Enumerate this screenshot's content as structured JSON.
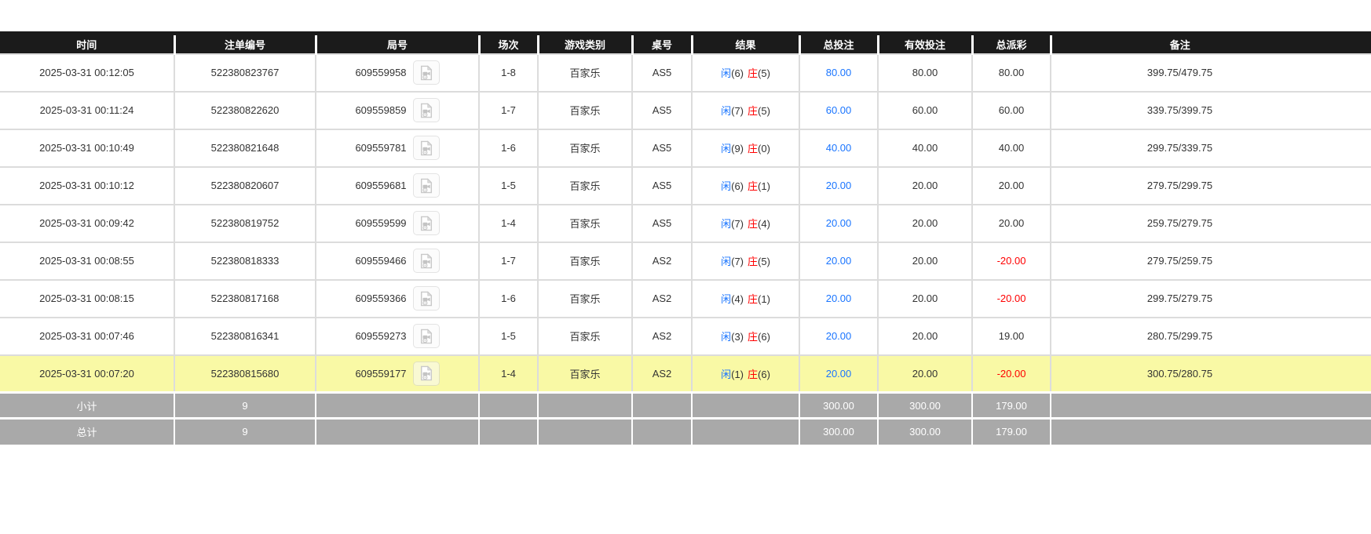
{
  "colors": {
    "header_bg": "#1b1b1b",
    "player_blue": "#1a75ff",
    "banker_red": "#ff0000",
    "bet_blue": "#1a75ff",
    "negative_red": "#ff0000",
    "highlight_yellow": "#f9f9a5",
    "footer_gray": "#a9a9a9"
  },
  "table": {
    "columns": [
      {
        "key": "time",
        "label": "时间"
      },
      {
        "key": "bet_id",
        "label": "注单编号"
      },
      {
        "key": "round",
        "label": "局号"
      },
      {
        "key": "session",
        "label": "场次"
      },
      {
        "key": "game_type",
        "label": "游戏类别"
      },
      {
        "key": "table_no",
        "label": "桌号"
      },
      {
        "key": "result",
        "label": "结果"
      },
      {
        "key": "total_bet",
        "label": "总投注"
      },
      {
        "key": "valid_bet",
        "label": "有效投注"
      },
      {
        "key": "total_payout",
        "label": "总派彩"
      },
      {
        "key": "remark",
        "label": "备注"
      }
    ],
    "rows": [
      {
        "time": "2025-03-31 00:12:05",
        "bet_id": "522380823767",
        "round": "609559958",
        "session": "1-8",
        "game_type": "百家乐",
        "table_no": "AS5",
        "result_player": "闲",
        "result_player_score": "(6)",
        "result_banker": "庄",
        "result_banker_score": "(5)",
        "total_bet": "80.00",
        "valid_bet": "80.00",
        "total_payout": "80.00",
        "remark": "399.75/479.75",
        "highlighted": false
      },
      {
        "time": "2025-03-31 00:11:24",
        "bet_id": "522380822620",
        "round": "609559859",
        "session": "1-7",
        "game_type": "百家乐",
        "table_no": "AS5",
        "result_player": "闲",
        "result_player_score": "(7)",
        "result_banker": "庄",
        "result_banker_score": "(5)",
        "total_bet": "60.00",
        "valid_bet": "60.00",
        "total_payout": "60.00",
        "remark": "339.75/399.75",
        "highlighted": false
      },
      {
        "time": "2025-03-31 00:10:49",
        "bet_id": "522380821648",
        "round": "609559781",
        "session": "1-6",
        "game_type": "百家乐",
        "table_no": "AS5",
        "result_player": "闲",
        "result_player_score": "(9)",
        "result_banker": "庄",
        "result_banker_score": "(0)",
        "total_bet": "40.00",
        "valid_bet": "40.00",
        "total_payout": "40.00",
        "remark": "299.75/339.75",
        "highlighted": false
      },
      {
        "time": "2025-03-31 00:10:12",
        "bet_id": "522380820607",
        "round": "609559681",
        "session": "1-5",
        "game_type": "百家乐",
        "table_no": "AS5",
        "result_player": "闲",
        "result_player_score": "(6)",
        "result_banker": "庄",
        "result_banker_score": "(1)",
        "total_bet": "20.00",
        "valid_bet": "20.00",
        "total_payout": "20.00",
        "remark": "279.75/299.75",
        "highlighted": false
      },
      {
        "time": "2025-03-31 00:09:42",
        "bet_id": "522380819752",
        "round": "609559599",
        "session": "1-4",
        "game_type": "百家乐",
        "table_no": "AS5",
        "result_player": "闲",
        "result_player_score": "(7)",
        "result_banker": "庄",
        "result_banker_score": "(4)",
        "total_bet": "20.00",
        "valid_bet": "20.00",
        "total_payout": "20.00",
        "remark": "259.75/279.75",
        "highlighted": false
      },
      {
        "time": "2025-03-31 00:08:55",
        "bet_id": "522380818333",
        "round": "609559466",
        "session": "1-7",
        "game_type": "百家乐",
        "table_no": "AS2",
        "result_player": "闲",
        "result_player_score": "(7)",
        "result_banker": "庄",
        "result_banker_score": "(5)",
        "total_bet": "20.00",
        "valid_bet": "20.00",
        "total_payout": "-20.00",
        "remark": "279.75/259.75",
        "highlighted": false
      },
      {
        "time": "2025-03-31 00:08:15",
        "bet_id": "522380817168",
        "round": "609559366",
        "session": "1-6",
        "game_type": "百家乐",
        "table_no": "AS2",
        "result_player": "闲",
        "result_player_score": "(4)",
        "result_banker": "庄",
        "result_banker_score": "(1)",
        "total_bet": "20.00",
        "valid_bet": "20.00",
        "total_payout": "-20.00",
        "remark": "299.75/279.75",
        "highlighted": false
      },
      {
        "time": "2025-03-31 00:07:46",
        "bet_id": "522380816341",
        "round": "609559273",
        "session": "1-5",
        "game_type": "百家乐",
        "table_no": "AS2",
        "result_player": "闲",
        "result_player_score": "(3)",
        "result_banker": "庄",
        "result_banker_score": "(6)",
        "total_bet": "20.00",
        "valid_bet": "20.00",
        "total_payout": "19.00",
        "remark": "280.75/299.75",
        "highlighted": false
      },
      {
        "time": "2025-03-31 00:07:20",
        "bet_id": "522380815680",
        "round": "609559177",
        "session": "1-4",
        "game_type": "百家乐",
        "table_no": "AS2",
        "result_player": "闲",
        "result_player_score": "(1)",
        "result_banker": "庄",
        "result_banker_score": "(6)",
        "total_bet": "20.00",
        "valid_bet": "20.00",
        "total_payout": "-20.00",
        "remark": "300.75/280.75",
        "highlighted": true
      }
    ],
    "footer": {
      "subtotal": {
        "label": "小计",
        "count": "9",
        "total_bet": "300.00",
        "valid_bet": "300.00",
        "total_payout": "179.00"
      },
      "total": {
        "label": "总计",
        "count": "9",
        "total_bet": "300.00",
        "valid_bet": "300.00",
        "total_payout": "179.00"
      }
    }
  },
  "icons": {
    "video_replay": "video-file-icon"
  }
}
